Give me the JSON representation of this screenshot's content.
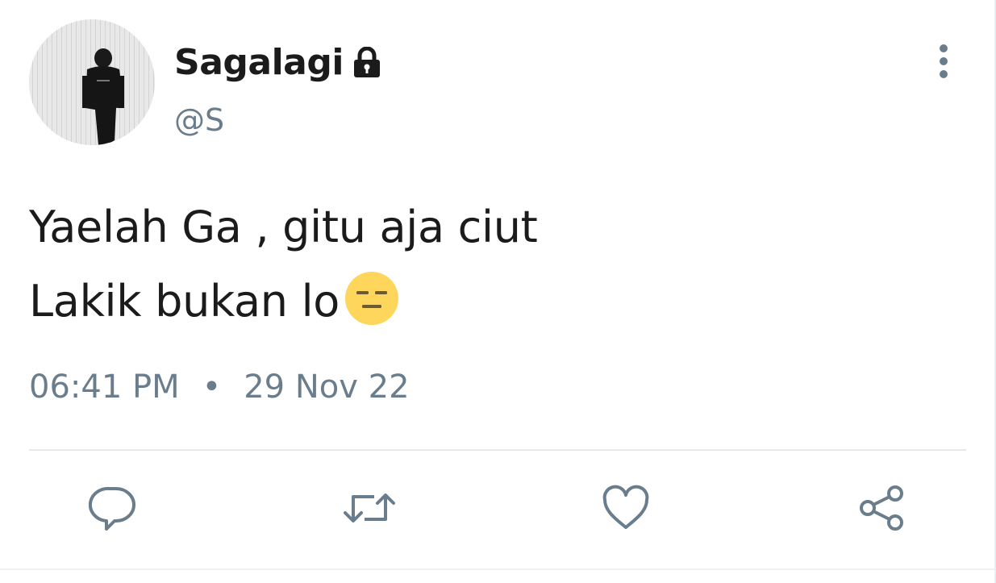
{
  "user": {
    "display_name": "Sagalagi",
    "handle": "@S",
    "avatar": "avatar-photo",
    "protected_icon": "lock-icon"
  },
  "tweet": {
    "lines": [
      "Yaelah Ga , gitu aja ciut",
      "Lakik bukan lo"
    ],
    "emoji": "expressionless-face-emoji"
  },
  "meta": {
    "time": "06:41 PM",
    "separator": "•",
    "date": "29 Nov 22"
  },
  "actions": [
    {
      "icon": "reply-icon"
    },
    {
      "icon": "retweet-icon"
    },
    {
      "icon": "like-icon"
    },
    {
      "icon": "share-icon"
    }
  ],
  "more_icon": "more-vertical-icon",
  "colors": {
    "text": "#1b1b1b",
    "secondary": "#6a7d8c",
    "divider": "#e6e9eb",
    "emoji_face": "#fdd65b"
  }
}
